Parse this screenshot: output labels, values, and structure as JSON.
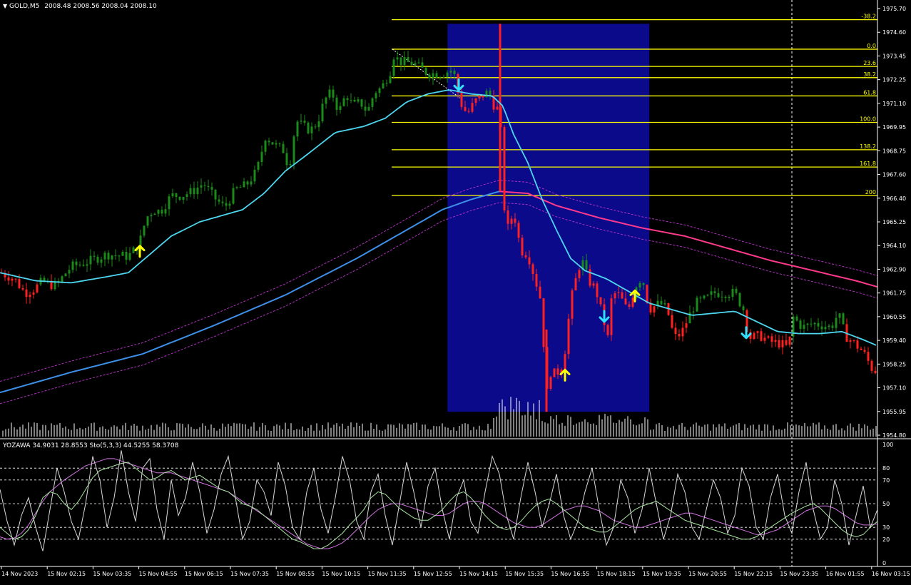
{
  "header": {
    "symbol": "GOLD,M5",
    "ohlc": "2008.48 2008.56 2008.04 2008.10",
    "indicator_label": "YOZAWA 34.9031 28.8553  Sto(5,3,3) 44.5255 58.3708"
  },
  "colors": {
    "background": "#000000",
    "bull": "#1a8a1a",
    "bear": "#ff2020",
    "ma_fast": "#4dd6f0",
    "ma_slow_up": "#3d8fe8",
    "ma_slow_down": "#ff3a8c",
    "envelope": "#b030c0",
    "fib": "#ffff00",
    "zone": "#0a0a8a",
    "vline": "#ff2020",
    "volume": "#ffffff",
    "arrow_up": "#ffff00",
    "arrow_down": "#30e0ff",
    "osc_white": "#d8d8d8",
    "osc_green": "#a8e8a0",
    "osc_violet": "#d070e0"
  },
  "chart_data": {
    "type": "candlestick",
    "price_axis": {
      "ticks": [
        "1975.70",
        "1974.60",
        "1973.45",
        "1972.25",
        "1971.10",
        "1969.95",
        "1968.75",
        "1967.60",
        "1966.40",
        "1965.25",
        "1964.10",
        "1962.90",
        "1961.75",
        "1960.55",
        "1959.40",
        "1958.25",
        "1957.10",
        "1955.95",
        "1954.80"
      ],
      "ylim": [
        1954.8,
        1975.8
      ]
    },
    "time_axis": {
      "labels": [
        "14 Nov 2023",
        "15 Nov 02:15",
        "15 Nov 03:35",
        "15 Nov 04:55",
        "15 Nov 06:15",
        "15 Nov 07:35",
        "15 Nov 08:55",
        "15 Nov 10:15",
        "15 Nov 11:35",
        "15 Nov 12:55",
        "15 Nov 14:15",
        "15 Nov 15:35",
        "15 Nov 16:55",
        "15 Nov 18:15",
        "15 Nov 19:35",
        "15 Nov 20:55",
        "15 Nov 22:15",
        "15 Nov 23:35",
        "16 Nov 01:55",
        "16 Nov 03:15"
      ]
    },
    "price_anchors": [
      [
        0,
        1962.8
      ],
      [
        20,
        1962.5
      ],
      [
        35,
        1961.8
      ],
      [
        48,
        1962.0
      ],
      [
        60,
        1962.4
      ],
      [
        70,
        1962.2
      ],
      [
        80,
        1962.2
      ],
      [
        90,
        1962.7
      ],
      [
        100,
        1963.1
      ],
      [
        120,
        1963.3
      ],
      [
        150,
        1963.7
      ],
      [
        180,
        1963.6
      ],
      [
        195,
        1964.2
      ],
      [
        205,
        1965.5
      ],
      [
        215,
        1965.9
      ],
      [
        225,
        1965.8
      ],
      [
        240,
        1966.6
      ],
      [
        255,
        1966.6
      ],
      [
        270,
        1966.8
      ],
      [
        285,
        1967.2
      ],
      [
        300,
        1966.5
      ],
      [
        315,
        1966.0
      ],
      [
        330,
        1966.9
      ],
      [
        345,
        1967.1
      ],
      [
        360,
        1967.8
      ],
      [
        372,
        1969.5
      ],
      [
        385,
        1969.1
      ],
      [
        398,
        1968.8
      ],
      [
        405,
        1967.9
      ],
      [
        415,
        1970.3
      ],
      [
        425,
        1970.0
      ],
      [
        435,
        1969.8
      ],
      [
        445,
        1970.2
      ],
      [
        455,
        1971.3
      ],
      [
        465,
        1971.7
      ],
      [
        475,
        1970.7
      ],
      [
        485,
        1971.6
      ],
      [
        495,
        1971.0
      ],
      [
        505,
        1971.2
      ],
      [
        515,
        1970.7
      ],
      [
        525,
        1971.7
      ],
      [
        535,
        1971.9
      ],
      [
        548,
        1972.8
      ],
      [
        552,
        1973.5
      ],
      [
        560,
        1973.2
      ],
      [
        580,
        1973.1
      ],
      [
        600,
        1972.6
      ],
      [
        620,
        1972.6
      ],
      [
        635,
        1972.8
      ],
      [
        645,
        1971.2
      ],
      [
        655,
        1970.6
      ],
      [
        665,
        1971.2
      ],
      [
        675,
        1971.5
      ],
      [
        685,
        1971.7
      ],
      [
        695,
        1970.8
      ],
      [
        701,
        1971.0
      ],
      [
        704,
        1967.2
      ],
      [
        710,
        1964.8
      ],
      [
        720,
        1965.8
      ],
      [
        730,
        1963.9
      ],
      [
        740,
        1963.7
      ],
      [
        750,
        1962.5
      ],
      [
        760,
        1961.2
      ],
      [
        765,
        1956.5
      ],
      [
        772,
        1957.9
      ],
      [
        780,
        1957.8
      ],
      [
        790,
        1958.4
      ],
      [
        800,
        1961.4
      ],
      [
        808,
        1962.6
      ],
      [
        815,
        1963.5
      ],
      [
        825,
        1962.4
      ],
      [
        835,
        1962.0
      ],
      [
        845,
        1960.6
      ],
      [
        852,
        1959.6
      ],
      [
        858,
        1961.8
      ],
      [
        868,
        1961.7
      ],
      [
        880,
        1960.9
      ],
      [
        890,
        1962.1
      ],
      [
        900,
        1962.6
      ],
      [
        910,
        1961.0
      ],
      [
        925,
        1961.3
      ],
      [
        935,
        1961.0
      ],
      [
        945,
        1959.6
      ],
      [
        955,
        1959.8
      ],
      [
        965,
        1960.6
      ],
      [
        975,
        1961.3
      ],
      [
        990,
        1961.5
      ],
      [
        1000,
        1961.8
      ],
      [
        1015,
        1961.8
      ],
      [
        1030,
        1961.8
      ],
      [
        1042,
        1961.0
      ],
      [
        1050,
        1959.6
      ],
      [
        1065,
        1959.7
      ],
      [
        1080,
        1959.4
      ],
      [
        1095,
        1959.3
      ],
      [
        1105,
        1959.1
      ],
      [
        1112,
        1960.6
      ],
      [
        1125,
        1960.1
      ],
      [
        1140,
        1960.3
      ],
      [
        1155,
        1960.2
      ],
      [
        1165,
        1960.1
      ],
      [
        1175,
        1960.8
      ],
      [
        1185,
        1959.7
      ],
      [
        1195,
        1959.4
      ],
      [
        1210,
        1958.9
      ],
      [
        1222,
        1958.1
      ],
      [
        1230,
        1957.9
      ]
    ],
    "ma_fast_anchors": [
      [
        0,
        1962.8
      ],
      [
        50,
        1962.4
      ],
      [
        100,
        1962.3
      ],
      [
        150,
        1962.6
      ],
      [
        180,
        1962.8
      ],
      [
        200,
        1963.4
      ],
      [
        240,
        1964.6
      ],
      [
        280,
        1965.3
      ],
      [
        310,
        1965.6
      ],
      [
        340,
        1965.9
      ],
      [
        370,
        1966.7
      ],
      [
        400,
        1967.8
      ],
      [
        430,
        1968.6
      ],
      [
        470,
        1969.7
      ],
      [
        510,
        1970.0
      ],
      [
        540,
        1970.4
      ],
      [
        570,
        1971.2
      ],
      [
        600,
        1971.6
      ],
      [
        630,
        1971.8
      ],
      [
        660,
        1971.6
      ],
      [
        690,
        1971.5
      ],
      [
        705,
        1971.0
      ],
      [
        720,
        1969.6
      ],
      [
        740,
        1968.2
      ],
      [
        760,
        1966.4
      ],
      [
        780,
        1964.9
      ],
      [
        800,
        1963.5
      ],
      [
        820,
        1962.9
      ],
      [
        850,
        1962.5
      ],
      [
        880,
        1961.9
      ],
      [
        910,
        1961.3
      ],
      [
        940,
        1961.0
      ],
      [
        970,
        1960.7
      ],
      [
        1000,
        1960.8
      ],
      [
        1030,
        1960.9
      ],
      [
        1060,
        1960.4
      ],
      [
        1090,
        1959.9
      ],
      [
        1120,
        1959.8
      ],
      [
        1150,
        1959.8
      ],
      [
        1180,
        1959.9
      ],
      [
        1210,
        1959.5
      ],
      [
        1230,
        1959.2
      ]
    ],
    "ma_slow_anchors": [
      [
        0,
        1956.9
      ],
      [
        100,
        1957.9
      ],
      [
        200,
        1958.8
      ],
      [
        300,
        1960.2
      ],
      [
        400,
        1961.7
      ],
      [
        500,
        1963.5
      ],
      [
        560,
        1964.7
      ],
      [
        620,
        1965.9
      ],
      [
        660,
        1966.4
      ],
      [
        700,
        1966.8
      ],
      [
        740,
        1966.7
      ],
      [
        780,
        1966.1
      ],
      [
        840,
        1965.5
      ],
      [
        900,
        1965.0
      ],
      [
        960,
        1964.6
      ],
      [
        1020,
        1964.0
      ],
      [
        1080,
        1963.4
      ],
      [
        1140,
        1962.9
      ],
      [
        1200,
        1962.4
      ],
      [
        1230,
        1962.1
      ]
    ],
    "envelope_offset": 0.55,
    "fibonacci": [
      {
        "level": "-38.2",
        "price": 1975.25
      },
      {
        "level": "0.0",
        "price": 1973.8
      },
      {
        "level": "23.6",
        "price": 1972.95
      },
      {
        "level": "38.2",
        "price": 1972.4
      },
      {
        "level": "61.8",
        "price": 1971.5
      },
      {
        "level": "100.0",
        "price": 1970.2
      },
      {
        "level": "138.2",
        "price": 1968.85
      },
      {
        "level": "161.8",
        "price": 1968.0
      },
      {
        "level": "200",
        "price": 1966.6
      }
    ],
    "arrows": [
      {
        "x": 196,
        "dir": "up",
        "price": 1963.8
      },
      {
        "x": 643,
        "dir": "down",
        "price": 1972.1
      },
      {
        "x": 792,
        "dir": "up",
        "price": 1957.7
      },
      {
        "x": 847,
        "dir": "down",
        "price": 1960.7
      },
      {
        "x": 890,
        "dir": "up",
        "price": 1961.6
      },
      {
        "x": 1046,
        "dir": "down",
        "price": 1959.9
      }
    ],
    "oscillator": {
      "levels": [
        100,
        80,
        70,
        50,
        30,
        20,
        0
      ],
      "values_white": [
        62,
        35,
        15,
        40,
        55,
        30,
        10,
        45,
        80,
        60,
        35,
        20,
        50,
        90,
        70,
        30,
        55,
        95,
        60,
        35,
        80,
        88,
        45,
        20,
        70,
        40,
        55,
        85,
        60,
        25,
        45,
        75,
        90,
        55,
        20,
        35,
        70,
        60,
        40,
        85,
        65,
        30,
        20,
        60,
        80,
        45,
        25,
        55,
        90,
        70,
        35,
        20,
        60,
        75,
        40,
        15,
        50,
        85,
        60,
        30,
        65,
        80,
        45,
        20,
        55,
        70,
        35,
        25,
        60,
        90,
        75,
        40,
        20,
        55,
        85,
        60,
        30,
        50,
        75,
        40,
        20,
        35,
        60,
        80,
        45,
        15,
        30,
        70,
        55,
        25,
        45,
        80,
        50,
        20,
        40,
        75,
        60,
        30,
        20,
        45,
        70,
        55,
        25,
        40,
        80,
        65,
        30,
        20,
        55,
        75,
        40,
        25,
        60,
        85,
        45,
        20,
        30,
        70,
        50,
        15,
        40,
        65,
        30,
        45
      ],
      "values_green": [
        30,
        25,
        20,
        22,
        28,
        40,
        55,
        60,
        58,
        50,
        45,
        52,
        62,
        72,
        78,
        80,
        82,
        84,
        85,
        80,
        75,
        70,
        72,
        76,
        78,
        74,
        70,
        72,
        74,
        70,
        66,
        62,
        60,
        55,
        50,
        48,
        45,
        40,
        35,
        30,
        25,
        20,
        18,
        15,
        12,
        12,
        15,
        20,
        25,
        32,
        38,
        45,
        55,
        60,
        58,
        52,
        46,
        42,
        38,
        36,
        36,
        40,
        45,
        52,
        58,
        60,
        55,
        48,
        40,
        34,
        30,
        28,
        30,
        35,
        42,
        48,
        52,
        54,
        50,
        45,
        40,
        35,
        30,
        28,
        26,
        26,
        30,
        35,
        40,
        45,
        48,
        50,
        52,
        48,
        44,
        40,
        36,
        34,
        32,
        30,
        28,
        26,
        24,
        22,
        20,
        20,
        22,
        26,
        30,
        34,
        38,
        42,
        45,
        48,
        50,
        46,
        40,
        34,
        28,
        24,
        22,
        24,
        30,
        35
      ],
      "values_violet": [
        22,
        20,
        21,
        25,
        32,
        42,
        52,
        60,
        65,
        70,
        74,
        78,
        82,
        84,
        86,
        88,
        88,
        86,
        84,
        82,
        80,
        78,
        76,
        76,
        76,
        74,
        72,
        70,
        68,
        66,
        64,
        62,
        60,
        56,
        52,
        48,
        44,
        40,
        36,
        32,
        28,
        24,
        20,
        16,
        14,
        12,
        12,
        14,
        17,
        22,
        28,
        34,
        40,
        45,
        48,
        50,
        50,
        48,
        46,
        44,
        42,
        40,
        40,
        42,
        46,
        50,
        52,
        52,
        50,
        46,
        42,
        38,
        34,
        32,
        30,
        30,
        32,
        36,
        40,
        44,
        46,
        48,
        48,
        46,
        44,
        40,
        36,
        34,
        32,
        30,
        30,
        32,
        34,
        36,
        38,
        40,
        42,
        42,
        40,
        38,
        36,
        34,
        32,
        30,
        28,
        26,
        24,
        24,
        26,
        28,
        32,
        36,
        40,
        44,
        46,
        48,
        48,
        46,
        42,
        38,
        34,
        32,
        32,
        33
      ]
    },
    "zone": {
      "x_start_frac": 0.51,
      "x_end_frac": 0.74
    }
  }
}
